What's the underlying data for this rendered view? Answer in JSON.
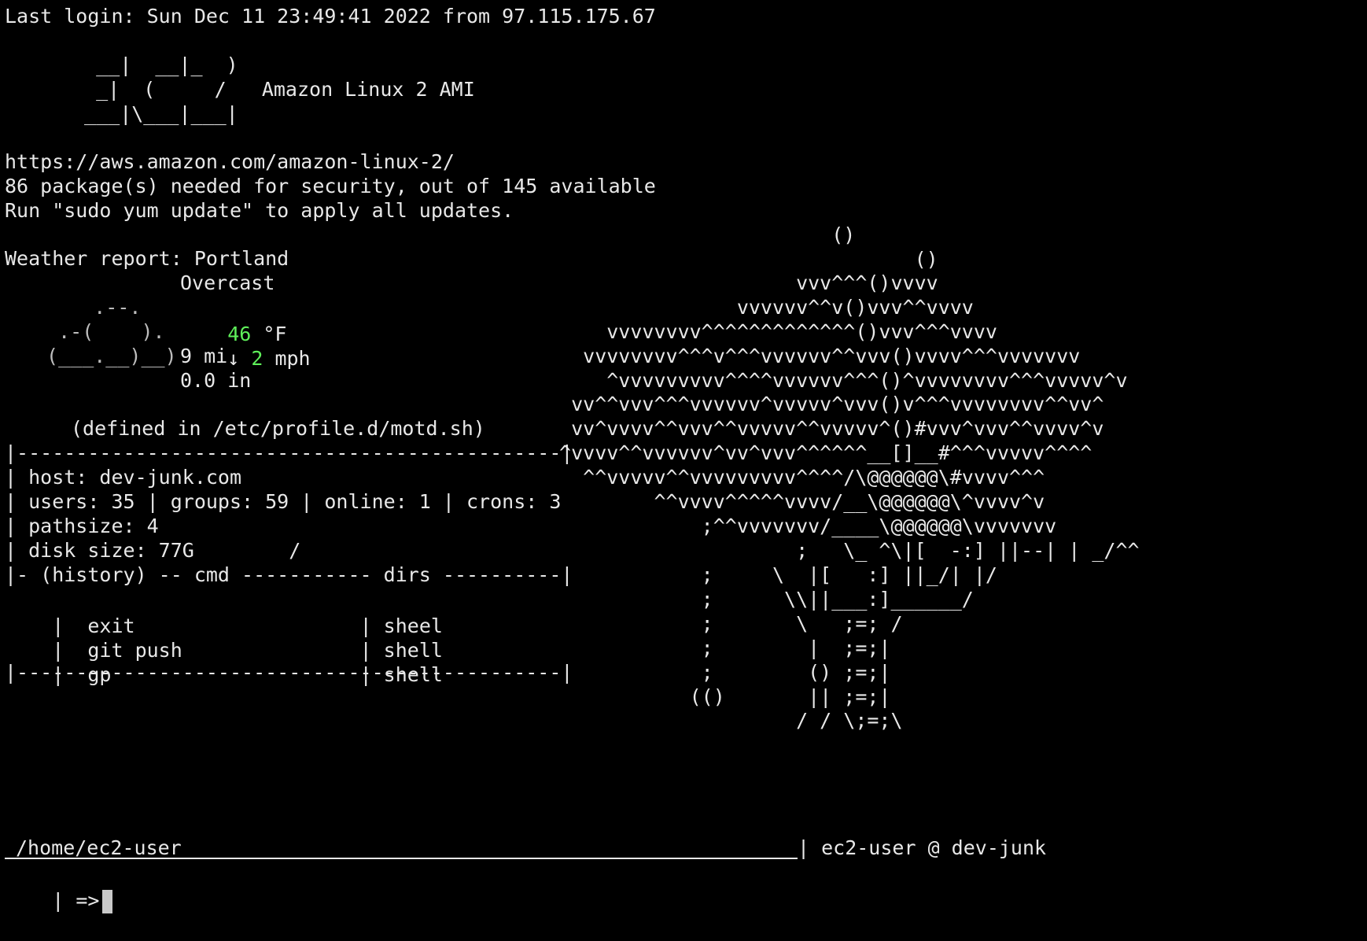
{
  "colors": {
    "background": "#000000",
    "text": "#e8e8e8",
    "accent_green": "#5ff05a",
    "cursor": "#c9c9c9"
  },
  "terminal": {
    "last_login": "Last login: Sun Dec 11 23:49:41 2022 from 97.115.175.67",
    "banner": {
      "line1": "  __|  __|_  )",
      "line2": "  _|  (     /   Amazon Linux 2 AMI",
      "line3": " ___|\\___|___|"
    },
    "motd": {
      "url": "https://aws.amazon.com/amazon-linux-2/",
      "packages": "86 package(s) needed for security, out of 145 available",
      "update_hint": "Run \"sudo yum update\" to apply all updates."
    },
    "weather": {
      "label": "Weather report: Portland",
      "condition": "Overcast",
      "cloud_art_1": "     .--.    ",
      "cloud_art_2": "  .-(    ).  ",
      "cloud_art_3": " (___.__)__) ",
      "temperature_value": "46",
      "temperature_unit": " °F",
      "wind_arrow": "↓ ",
      "wind_value": "2",
      "wind_unit": " mph",
      "visibility": "9 mi",
      "precipitation": "0.0 in"
    },
    "defined_in": "(defined in /etc/profile.d/motd.sh)",
    "infobox": {
      "border_top": "|----------------------------------------------|",
      "host": "| host: dev-junk.com",
      "stats": "| users: 35 | groups: 59 | online: 1 | crons: 3",
      "pathsize": "| pathsize: 4",
      "disk": "| disk size: 77G        /",
      "history_header": "|- (history) -- cmd ----------- dirs ----------|",
      "history": [
        {
          "cmd": "|  exit                   ",
          "dir": "| sheel"
        },
        {
          "cmd": "|  git push               ",
          "dir": "| shell"
        },
        {
          "cmd": "|  gp                     ",
          "dir": "| shell"
        }
      ],
      "border_bottom": "|----------------------------------------------|"
    },
    "ascii_art": [
      "                        ()",
      "                               ()",
      "                     vvv^^^()vvvv",
      "                vvvvvv^^v()vvv^^vvvv",
      "     vvvvvvvv^^^^^^^^^^^^^()vvv^^^vvvv",
      "   vvvvvvvv^^^v^^^vvvvvv^^vvv()vvvv^^^vvvvvvv",
      "     ^vvvvvvvvv^^^^vvvvvv^^^()^vvvvvvvv^^^vvvvv^v",
      "  vv^^vvv^^^vvvvvv^vvvvv^vvv()v^^^vvvvvvvv^^vv^",
      "  vv^vvvv^^vvv^^vvvvv^^vvvvv^()#vvv^vvv^^vvvv^v",
      " ^vvvv^^vvvvvv^vv^vvv^^^^^^__[]__#^^^vvvvv^^^^",
      "   ^^vvvvv^^vvvvvvvvv^^^^/\\@@@@@@\\#vvvv^^^",
      "         ^^vvvv^^^^^vvvv/__\\@@@@@@\\^vvvv^v",
      "             ;^^vvvvvvv/____\\@@@@@@\\vvvvvvv",
      "                     ;   \\_ ^\\|[  -:] ||--| | _/^^",
      "             ;     \\  |[   :] ||_/| |/",
      "             ;      \\\\||___:]______/",
      "             ;       \\   ;=; /",
      "             ;        |  ;=;|",
      "             ;        () ;=;|",
      "            (()       || ;=;|",
      "                     / / \\;=;\\"
    ],
    "prompt": {
      "path": "/home/ec2-user",
      "user_host": "| ec2-user @ dev-junk",
      "input_prefix": "| =>"
    }
  }
}
